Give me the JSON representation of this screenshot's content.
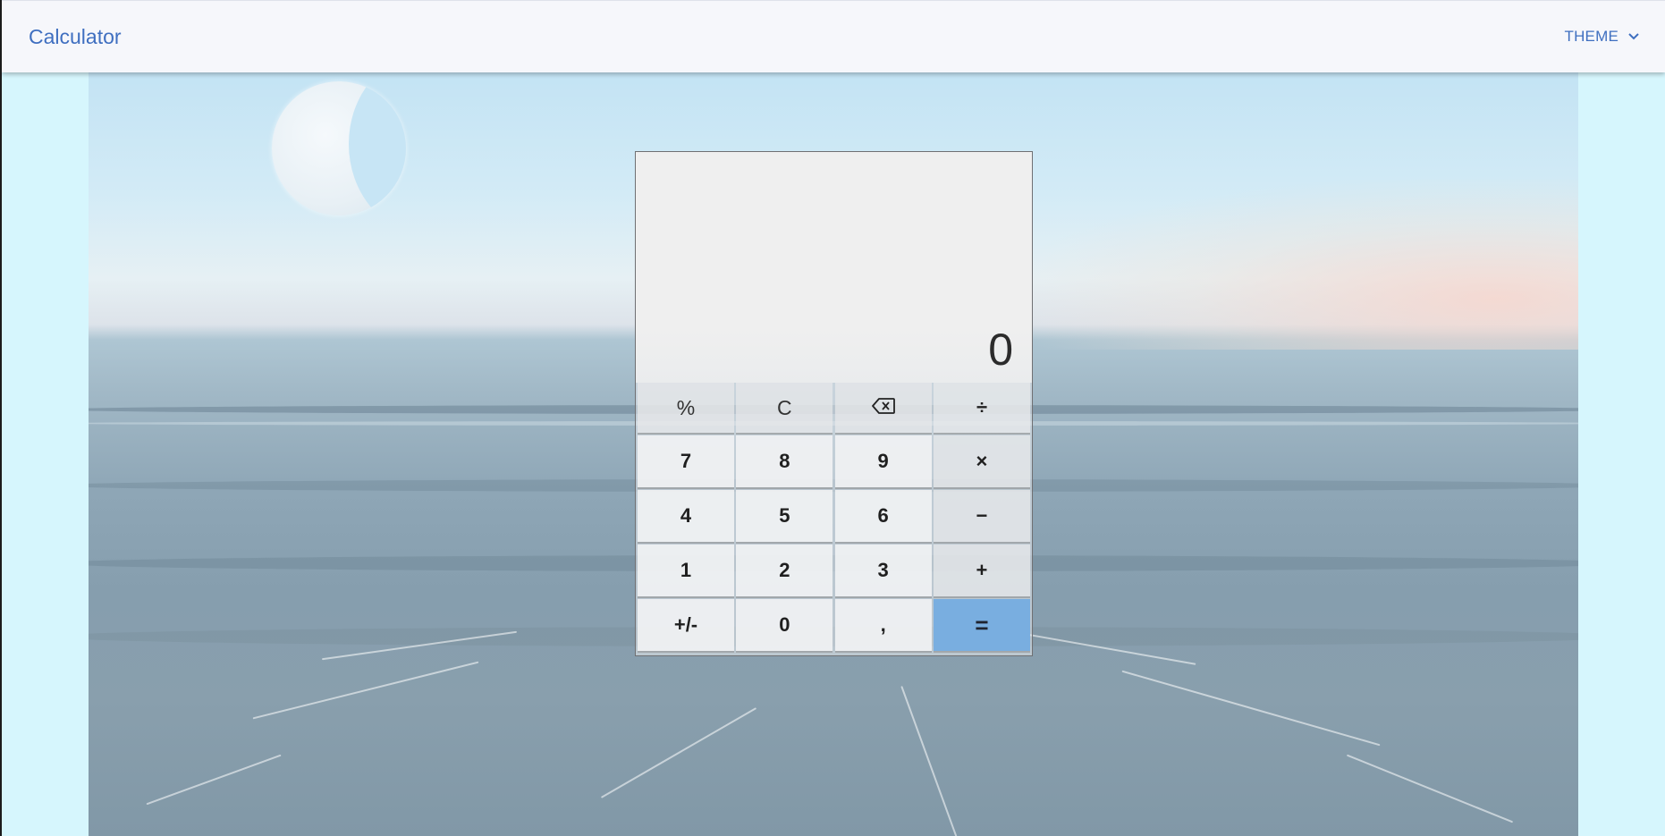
{
  "header": {
    "title": "Calculator",
    "theme_label": "THEME",
    "theme_icon": "chevron-down-icon",
    "accent": "#3f6fc0"
  },
  "display": {
    "value": "0"
  },
  "keypad": {
    "rows": [
      [
        {
          "label": "%",
          "name": "percent-button",
          "kind": "fn"
        },
        {
          "label": "C",
          "name": "clear-button",
          "kind": "fn"
        },
        {
          "label": "",
          "name": "backspace-button",
          "kind": "fn",
          "icon": "backspace-icon"
        },
        {
          "label": "÷",
          "name": "divide-button",
          "kind": "op"
        }
      ],
      [
        {
          "label": "7",
          "name": "digit-7-button",
          "kind": "num"
        },
        {
          "label": "8",
          "name": "digit-8-button",
          "kind": "num"
        },
        {
          "label": "9",
          "name": "digit-9-button",
          "kind": "num"
        },
        {
          "label": "×",
          "name": "multiply-button",
          "kind": "op"
        }
      ],
      [
        {
          "label": "4",
          "name": "digit-4-button",
          "kind": "num"
        },
        {
          "label": "5",
          "name": "digit-5-button",
          "kind": "num"
        },
        {
          "label": "6",
          "name": "digit-6-button",
          "kind": "num"
        },
        {
          "label": "−",
          "name": "subtract-button",
          "kind": "op"
        }
      ],
      [
        {
          "label": "1",
          "name": "digit-1-button",
          "kind": "num"
        },
        {
          "label": "2",
          "name": "digit-2-button",
          "kind": "num"
        },
        {
          "label": "3",
          "name": "digit-3-button",
          "kind": "num"
        },
        {
          "label": "+",
          "name": "add-button",
          "kind": "op"
        }
      ],
      [
        {
          "label": "+/-",
          "name": "toggle-sign-button",
          "kind": "num"
        },
        {
          "label": "0",
          "name": "digit-0-button",
          "kind": "num"
        },
        {
          "label": ",",
          "name": "decimal-button",
          "kind": "num"
        },
        {
          "label": "=",
          "name": "equals-button",
          "kind": "eq"
        }
      ]
    ],
    "equals_color": "#79aee0"
  }
}
